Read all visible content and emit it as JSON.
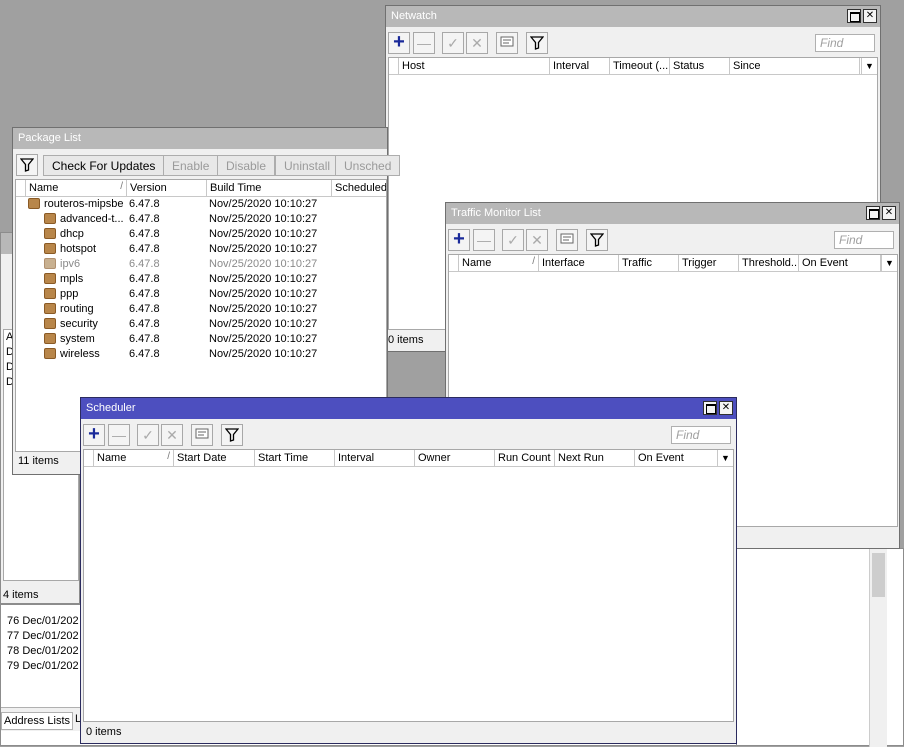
{
  "netwatch": {
    "title": "Netwatch",
    "find_placeholder": "Find",
    "columns": [
      "Host",
      "Interval",
      "Timeout (...",
      "Status",
      "Since"
    ],
    "status": "0 items"
  },
  "traffic_monitor": {
    "title": "Traffic Monitor List",
    "find_placeholder": "Find",
    "columns": [
      "Name",
      "Interface",
      "Traffic",
      "Trigger",
      "Threshold...",
      "On Event"
    ],
    "status": ""
  },
  "package_list": {
    "title": "Package List",
    "buttons": [
      "Check For Updates",
      "Enable",
      "Disable",
      "Uninstall",
      "Unsched"
    ],
    "columns": [
      "Name",
      "Version",
      "Build Time",
      "Scheduled"
    ],
    "rows": [
      {
        "name": "routeros-mipsbe",
        "version": "6.47.8",
        "build": "Nov/25/2020 10:10:27",
        "indent": 0,
        "disabled": false
      },
      {
        "name": "advanced-t...",
        "version": "6.47.8",
        "build": "Nov/25/2020 10:10:27",
        "indent": 1,
        "disabled": false
      },
      {
        "name": "dhcp",
        "version": "6.47.8",
        "build": "Nov/25/2020 10:10:27",
        "indent": 1,
        "disabled": false
      },
      {
        "name": "hotspot",
        "version": "6.47.8",
        "build": "Nov/25/2020 10:10:27",
        "indent": 1,
        "disabled": false
      },
      {
        "name": "ipv6",
        "version": "6.47.8",
        "build": "Nov/25/2020 10:10:27",
        "indent": 1,
        "disabled": true
      },
      {
        "name": "mpls",
        "version": "6.47.8",
        "build": "Nov/25/2020 10:10:27",
        "indent": 1,
        "disabled": false
      },
      {
        "name": "ppp",
        "version": "6.47.8",
        "build": "Nov/25/2020 10:10:27",
        "indent": 1,
        "disabled": false
      },
      {
        "name": "routing",
        "version": "6.47.8",
        "build": "Nov/25/2020 10:10:27",
        "indent": 1,
        "disabled": false
      },
      {
        "name": "security",
        "version": "6.47.8",
        "build": "Nov/25/2020 10:10:27",
        "indent": 1,
        "disabled": false
      },
      {
        "name": "system",
        "version": "6.47.8",
        "build": "Nov/25/2020 10:10:27",
        "indent": 1,
        "disabled": false
      },
      {
        "name": "wireless",
        "version": "6.47.8",
        "build": "Nov/25/2020 10:10:27",
        "indent": 1,
        "disabled": false
      }
    ],
    "status": "11 items"
  },
  "scheduler": {
    "title": "Scheduler",
    "find_placeholder": "Find",
    "columns": [
      "Name",
      "Start Date",
      "Start Time",
      "Interval",
      "Owner",
      "Run Count",
      "Next Run",
      "On Event"
    ],
    "status": "0 items"
  },
  "background": {
    "left_status": "4 items",
    "left_letters": [
      "A",
      "D",
      "D",
      "D"
    ],
    "log_rows": [
      {
        "num": "76",
        "date": "Dec/01/202"
      },
      {
        "num": "77",
        "date": "Dec/01/202"
      },
      {
        "num": "78",
        "date": "Dec/01/202"
      },
      {
        "num": "79",
        "date": "Dec/01/202"
      }
    ],
    "tab_address_lists": "Address Lists",
    "tab_partial": "L"
  },
  "colors": {
    "active_title": "#4d4fbf",
    "inactive_title": "#b8b8b8",
    "add_icon": "#1a2a9a"
  }
}
